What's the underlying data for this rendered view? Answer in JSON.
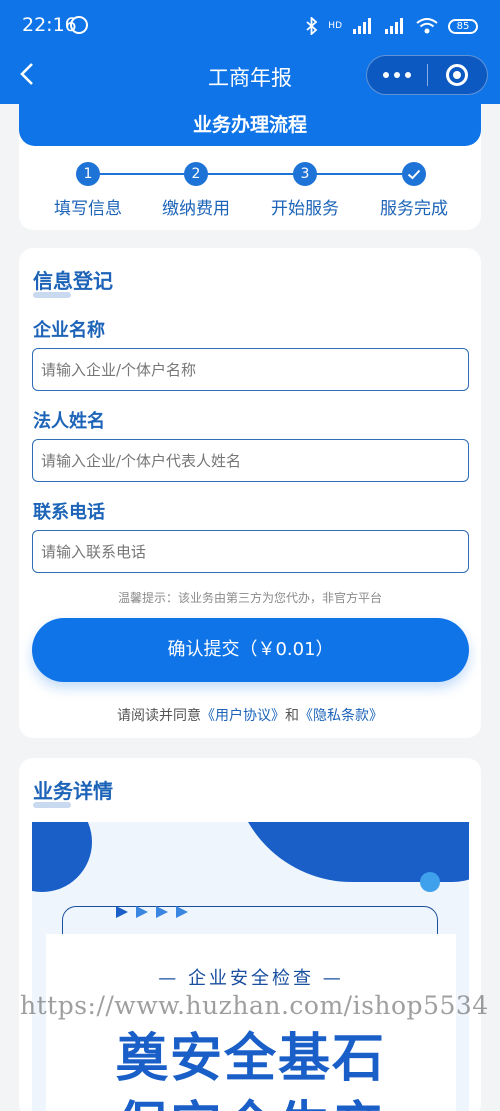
{
  "status_bar": {
    "time": "22:16",
    "signal_text": "HD",
    "battery": "85"
  },
  "nav": {
    "title": "工商年报"
  },
  "process": {
    "title": "业务办理流程",
    "steps": [
      {
        "num": "1",
        "label": "填写信息"
      },
      {
        "num": "2",
        "label": "缴纳费用"
      },
      {
        "num": "3",
        "label": "开始服务"
      },
      {
        "num": "",
        "label": "服务完成"
      }
    ]
  },
  "form": {
    "title": "信息登记",
    "company_label": "企业名称",
    "company_placeholder": "请输入企业/个体户名称",
    "legal_label": "法人姓名",
    "legal_placeholder": "请输入企业/个体户代表人姓名",
    "phone_label": "联系电话",
    "phone_placeholder": "请输入联系电话",
    "tip": "温馨提示：该业务由第三方为您代办，非官方平台",
    "submit_label": "确认提交（￥0.01）",
    "agree_prefix": "请阅读并同意",
    "user_agreement": "《用户协议》",
    "agree_and": "和",
    "privacy": "《隐私条款》"
  },
  "detail": {
    "title": "业务详情",
    "poster_sub": "— 企业安全检查 —",
    "poster_line1": "奠安全基石",
    "poster_line2": "保安全生产"
  },
  "watermark": "https://www.huzhan.com/ishop5534",
  "colors": {
    "primary": "#0f74e8",
    "text_blue": "#1d64b8",
    "page_bg": "#f3f4f6"
  },
  "icons": [
    "alarm-icon",
    "bluetooth-icon",
    "wifi-icon",
    "battery-icon",
    "back-arrow-icon",
    "more-icon",
    "close-target-icon",
    "check-icon"
  ]
}
